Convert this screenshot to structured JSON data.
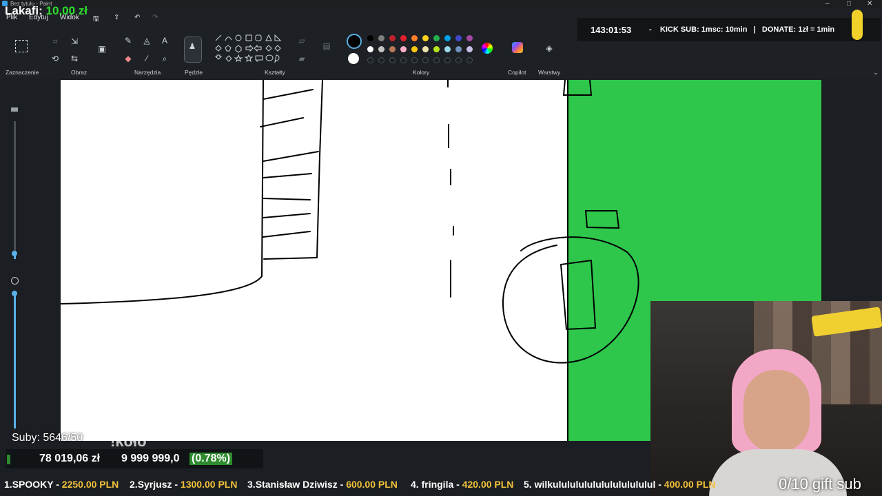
{
  "window": {
    "title": "Bez tytułu - Paint"
  },
  "menu": [
    "Plik",
    "Edytuj",
    "Widok"
  ],
  "ribbon_groups": {
    "selection": "Zaznaczenie",
    "image": "Obraz",
    "tools": "Narzędzia",
    "brushes": "Pędzle",
    "shapes": "Kształty",
    "colors": "Kolory",
    "copilot": "Copilot",
    "layers": "Warstwy"
  },
  "colors": {
    "row1": [
      "#000000",
      "#7f7f7f",
      "#c0222b",
      "#e5202e",
      "#ff7f27",
      "#ffd21f",
      "#22b14c",
      "#00a2e8",
      "#3f48cc",
      "#a349a4"
    ],
    "row2": [
      "#ffffff",
      "#c3c3c3",
      "#b97a57",
      "#ffaec9",
      "#ffc90e",
      "#efe4b0",
      "#b5e61d",
      "#99d9ea",
      "#7092be",
      "#c8bfe7"
    ],
    "active_primary": "#000000",
    "active_secondary": "#ffffff",
    "canvas_green": "#2ec74c"
  },
  "overlay": {
    "donor_name": "Lakafi:",
    "donor_amount": "10,00 zł",
    "timer": "143:01:53",
    "separator1": "-",
    "kick_sub": "KICK SUB: 1msc: 10min",
    "separator2": "|",
    "donate": "DONATE: 1zł = 1min",
    "subs": "Suby: 5646/50",
    "kolo": "!koło",
    "goal_current": "78 019,06 zł",
    "goal_target": "9 999 999,0",
    "goal_pct": "(0.78%)",
    "gift_sub": "0/10 gift sub",
    "ticker": [
      {
        "rank": "1.",
        "name": "SPOOKY",
        "amount": "2250.00 PLN"
      },
      {
        "rank": "2.",
        "name": "Syrjusz",
        "amount": "1300.00 PLN"
      },
      {
        "rank": "3.",
        "name": "Stanisław Dziwisz",
        "amount": "600.00 PLN"
      },
      {
        "rank": "4.",
        "name": "fringila",
        "amount": "420.00 PLN"
      },
      {
        "rank": "5.",
        "name": "wilkulululululululululululul",
        "amount": "400.00 PLN"
      }
    ]
  }
}
